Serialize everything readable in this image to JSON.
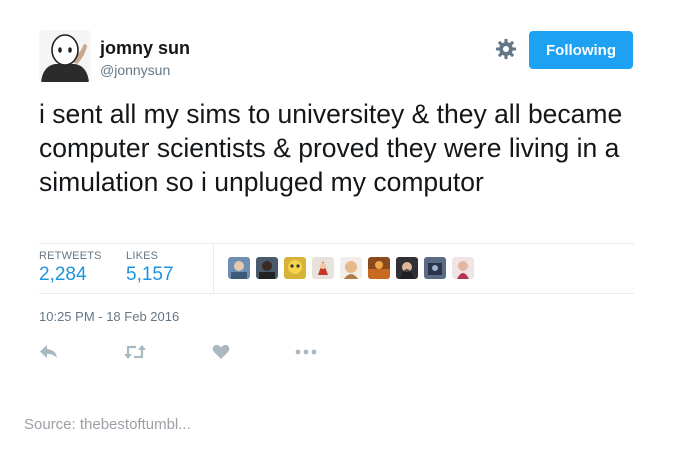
{
  "tweet": {
    "user": {
      "name": "jomny sun",
      "handle": "@jonnysun"
    },
    "follow_button_label": "Following",
    "text": "i sent all my sims to universitey & they all became computer scientists & proved they were living in a simulation so i unpluged my computor",
    "stats": {
      "retweets_label": "RETWEETS",
      "retweets_count": "2,284",
      "likes_label": "LIKES",
      "likes_count": "5,157"
    },
    "timestamp": "10:25 PM - 18 Feb 2016",
    "actions": [
      "reply-icon",
      "retweet-icon",
      "heart-icon",
      "more-icon"
    ]
  },
  "source_caption": "Source: thebestoftumbl...",
  "colors": {
    "accent": "#1da1f2",
    "link": "#1b95e0",
    "muted": "#657786",
    "action_icons": "#aab8c2",
    "divider": "#e6ecf0"
  }
}
